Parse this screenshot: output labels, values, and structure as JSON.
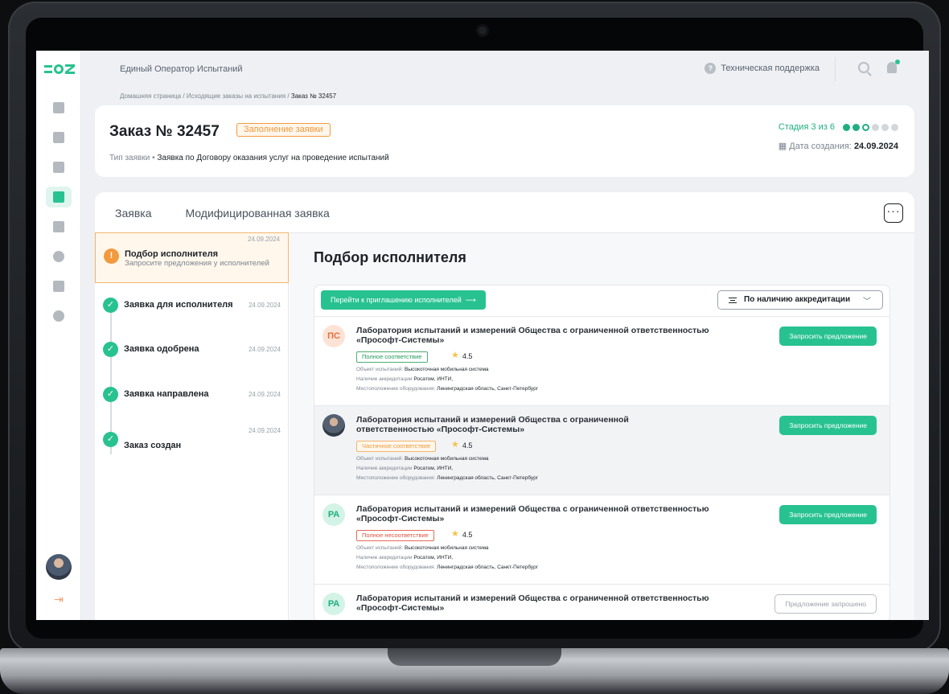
{
  "app": {
    "title": "Единый Оператор Испытаний"
  },
  "topbar": {
    "support_label": "Техническая поддержка"
  },
  "breadcrumbs": {
    "home": "Домашняя страница",
    "sep": "/",
    "outgoing": "Исходящие заказы на испытания",
    "current": "Заказ № 32457"
  },
  "order": {
    "title": "Заказ № 32457",
    "status": "Заполнение заявки",
    "type_label": "Тип заявки",
    "type_sep": "•",
    "type_value": "Заявка по Договору оказания услуг на проведение испытаний",
    "stage_label": "Стадия 3 из 6",
    "stage_done": 2,
    "stage_total": 6,
    "created_label": "Дата создания:",
    "created_value": "24.09.2024"
  },
  "tabs": [
    {
      "label": "Заявка"
    },
    {
      "label": "Модифицированная заявка"
    }
  ],
  "more_label": "···",
  "steps": [
    {
      "label": "Подбор исполнителя",
      "sub": "Запросите предложения у исполнителей",
      "date": "24.09.2024",
      "state": "warning",
      "mark": "!"
    },
    {
      "label": "Заявка для исполнителя",
      "date": "24.09.2024",
      "state": "done",
      "mark": "✓"
    },
    {
      "label": "Заявка одобрена",
      "date": "24.09.2024",
      "state": "done",
      "mark": "✓"
    },
    {
      "label": "Заявка направлена",
      "date": "24.09.2024",
      "state": "done",
      "mark": "✓"
    },
    {
      "label": "Заказ создан",
      "date": "24.09.2024",
      "state": "done",
      "mark": "✓"
    }
  ],
  "content": {
    "title": "Подбор исполнителя",
    "invite_label": "Перейти к приглашению исполнителей",
    "invite_arrow": "⟶",
    "filter_label": "По наличию аккредитации",
    "filter_chevron": "﹀"
  },
  "meta_labels": {
    "object": "Объект испытаний:",
    "accreditation": "Наличие аккредитации",
    "location": "Местоположение оборудования:"
  },
  "labs": [
    {
      "initials": "ПС",
      "avatar_color": "#fde3d6",
      "avatar_text": "#e56f3d",
      "name": "Лаборатория испытаний и измерений Общества с ограниченной ответственностью «Прософт-Системы»",
      "badge": "Полное соответствие",
      "badge_kind": "full",
      "rating": "4.5",
      "object": "Высокоточная мобильная система",
      "accreditation": "Росатом, ИНТИ,",
      "location": "Ленинградская область, Санкт-Петербург",
      "action": "Запросить предложение",
      "action_state": "request"
    },
    {
      "initials": "",
      "photo": true,
      "name": "Лаборатория испытаний и измерений Общества с ограниченной ответственностью «Прософт-Системы»",
      "badge": "Частичное соответствие",
      "badge_kind": "partial",
      "rating": "4.5",
      "object": "Высокоточная мобильная система",
      "accreditation": "Росатом, ИНТИ,",
      "location": "Ленинградская область, Санкт-Петербург",
      "action": "Запросить предложение",
      "action_state": "request"
    },
    {
      "initials": "РА",
      "avatar_color": "#d3f3e6",
      "avatar_text": "#1fae80",
      "name": "Лаборатория испытаний и измерений Общества с ограниченной ответственностью «Прософт-Системы»",
      "badge": "Полное несоответствие",
      "badge_kind": "none",
      "rating": "4.5",
      "object": "Высокоточная мобильная система",
      "accreditation": "Росатом, ИНТИ,",
      "location": "Ленинградская область, Санкт-Петербург",
      "action": "Запросить предложение",
      "action_state": "request"
    },
    {
      "initials": "РА",
      "avatar_color": "#d3f3e6",
      "avatar_text": "#1fae80",
      "name": "Лаборатория испытаний и измерений Общества с ограниченной ответственностью «Прософт-Системы»",
      "action": "Предложение запрошено",
      "action_state": "requested"
    }
  ],
  "sidebar": {
    "icons": [
      "home-icon",
      "document-icon",
      "grid-icon",
      "list-icon",
      "briefcase-icon",
      "pie-chart-icon",
      "pages-icon",
      "info-icon"
    ],
    "active": 3,
    "logout_icon": "⇥"
  },
  "colors": {
    "accent": "#28c290",
    "warning": "#f19a3e"
  }
}
